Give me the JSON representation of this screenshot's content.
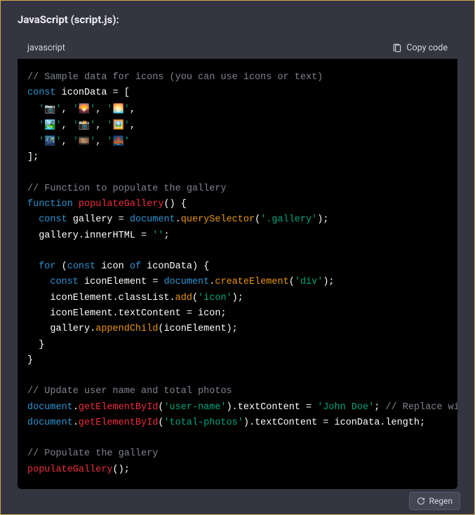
{
  "title": "JavaScript (script.js):",
  "header": {
    "language": "javascript",
    "copy_label": "Copy code"
  },
  "code": {
    "l1": "// Sample data for icons (you can use icons or text)",
    "l2a": "const",
    "l2b": " iconData = [",
    "l3_q": "'",
    "l3_e1": "📷",
    "l3_e2": "🌄",
    "l3_e3": "🌅",
    "l4_e1": "🏞️",
    "l4_e2": "📸",
    "l4_e3": "🖼️",
    "l5_e1": "🌃",
    "l5_e2": "🎞️",
    "l5_e3": "🌉",
    "l6": "];",
    "l8": "// Function to populate the gallery",
    "l9a": "function",
    "l9b": "populateGallery",
    "l9c": "() {",
    "l10a": "const",
    "l10b": " gallery = ",
    "l10c": "document",
    "l10d": ".",
    "l10e": "querySelector",
    "l10f": "(",
    "l10g": "'.gallery'",
    "l10h": ");",
    "l11a": "  gallery.innerHTML = ",
    "l11b": "''",
    "l11c": ";",
    "l13a": "for",
    "l13b": " (",
    "l13c": "const",
    "l13d": " icon ",
    "l13e": "of",
    "l13f": " iconData) {",
    "l14a": "const",
    "l14b": " iconElement = ",
    "l14c": "document",
    "l14d": ".",
    "l14e": "createElement",
    "l14f": "(",
    "l14g": "'div'",
    "l14h": ");",
    "l15a": "    iconElement.classList.",
    "l15b": "add",
    "l15c": "(",
    "l15d": "'icon'",
    "l15e": ");",
    "l16": "    iconElement.textContent = icon;",
    "l17a": "    gallery.",
    "l17b": "appendChild",
    "l17c": "(iconElement);",
    "l18": "  }",
    "l19": "}",
    "l21": "// Update user name and total photos",
    "l22a": "document",
    "l22b": ".",
    "l22c": "getElementById",
    "l22d": "(",
    "l22e": "'user-name'",
    "l22f": ").textContent = ",
    "l22g": "'John Doe'",
    "l22h": "; ",
    "l22i": "// Replace wi",
    "l23a": "document",
    "l23b": ".",
    "l23c": "getElementById",
    "l23d": "(",
    "l23e": "'total-photos'",
    "l23f": ").textContent = iconData.length;",
    "l25": "// Populate the gallery",
    "l26a": "populateGallery",
    "l26b": "();"
  },
  "regen_label": "Regen"
}
